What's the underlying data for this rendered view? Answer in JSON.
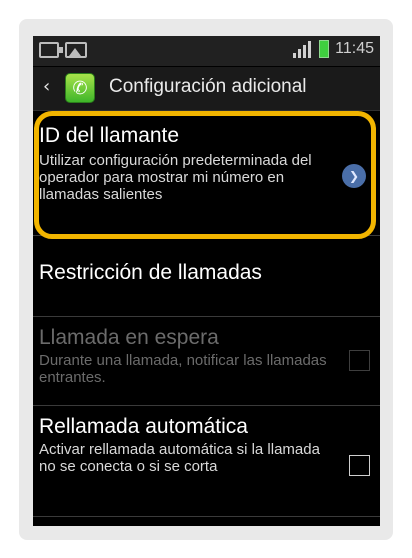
{
  "status_bar": {
    "left_icons": [
      "usb-debugging-icon",
      "image-notification-icon"
    ],
    "right_icons": [
      "signal-icon",
      "battery-icon"
    ],
    "time": "11:45"
  },
  "header": {
    "back_icon": "back-arrow",
    "app_icon": "phone-icon",
    "title": "Configuración adicional"
  },
  "settings": {
    "items": [
      {
        "title": "ID del llamante",
        "subtitle": "Utilizar configuración predeterminada del operador para mostrar mi número en llamadas salientes",
        "chevron": "chevron-right-icon"
      },
      {
        "title": "Restricción de llamadas"
      },
      {
        "title": "Llamada en espera",
        "subtitle": "Durante una llamada, notificar las llamadas entrantes.",
        "checked": false
      },
      {
        "title": "Rellamada automática",
        "subtitle": "Activar rellamada automática si la llamada no se conecta o si se corta",
        "checked": false
      }
    ]
  },
  "colors": {
    "highlight": "#f2b500",
    "phone_icon_green": "#3fb62a",
    "disabled_text": "#6b6b6b"
  }
}
